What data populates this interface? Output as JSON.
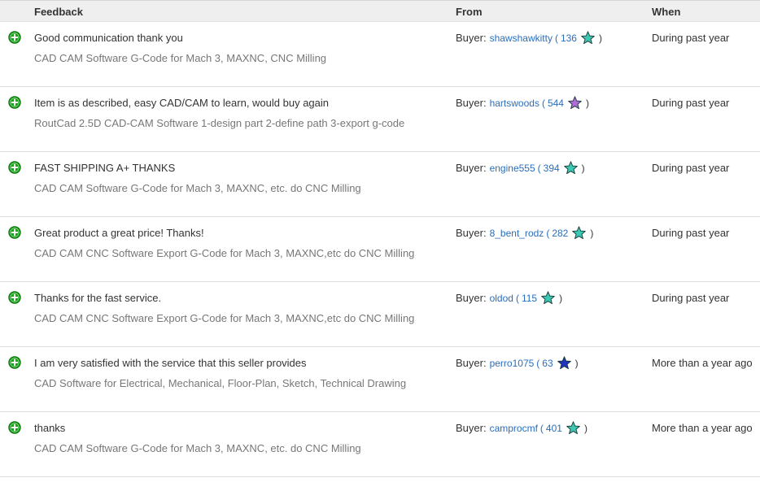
{
  "header": {
    "feedback": "Feedback",
    "from": "From",
    "when": "When"
  },
  "colors": {
    "positive": "#1aa31a",
    "link": "#2a6ebb",
    "star_turquoise": "#3cc9b4",
    "star_purple": "#b16ad9",
    "star_blue": "#2235b8"
  },
  "rows": [
    {
      "comment": "Good communication thank you",
      "item": "CAD CAM Software G-Code for Mach 3, MAXNC, CNC Milling",
      "buyer_label": "Buyer:",
      "user": "shawshawkitty",
      "score": "136",
      "star": "turquoise-star",
      "when": "During past year"
    },
    {
      "comment": "Item is as described, easy CAD/CAM to learn, would buy again",
      "item": "RoutCad 2.5D CAD-CAM Software 1-design part 2-define path 3-export g-code",
      "buyer_label": "Buyer:",
      "user": "hartswoods",
      "score": "544",
      "star": "purple-star",
      "when": "During past year"
    },
    {
      "comment": "FAST SHIPPING A+ THANKS",
      "item": "CAD CAM Software G-Code for Mach 3, MAXNC, etc. do CNC Milling",
      "buyer_label": "Buyer:",
      "user": "engine555",
      "score": "394",
      "star": "turquoise-star",
      "when": "During past year"
    },
    {
      "comment": "Great product a great price! Thanks!",
      "item": "CAD CAM CNC Software Export G-Code for Mach 3, MAXNC,etc do CNC Milling",
      "buyer_label": "Buyer:",
      "user": "8_bent_rodz",
      "score": "282",
      "star": "turquoise-star",
      "when": "During past year"
    },
    {
      "comment": "Thanks for the fast service.",
      "item": "CAD CAM CNC Software Export G-Code for Mach 3, MAXNC,etc do CNC Milling",
      "buyer_label": "Buyer:",
      "user": "oldod",
      "score": "115",
      "star": "turquoise-star",
      "when": "During past year"
    },
    {
      "comment": "I am very satisfied with the service that this seller provides",
      "item": "CAD Software for Electrical, Mechanical, Floor-Plan, Sketch, Technical Drawing",
      "buyer_label": "Buyer:",
      "user": "perro1075",
      "score": "63",
      "star": "blue-star",
      "when": "More than a year ago"
    },
    {
      "comment": "thanks",
      "item": "CAD CAM Software G-Code for Mach 3, MAXNC, etc. do CNC Milling",
      "buyer_label": "Buyer:",
      "user": "camprocmf",
      "score": "401",
      "star": "turquoise-star",
      "when": "More than a year ago"
    }
  ]
}
